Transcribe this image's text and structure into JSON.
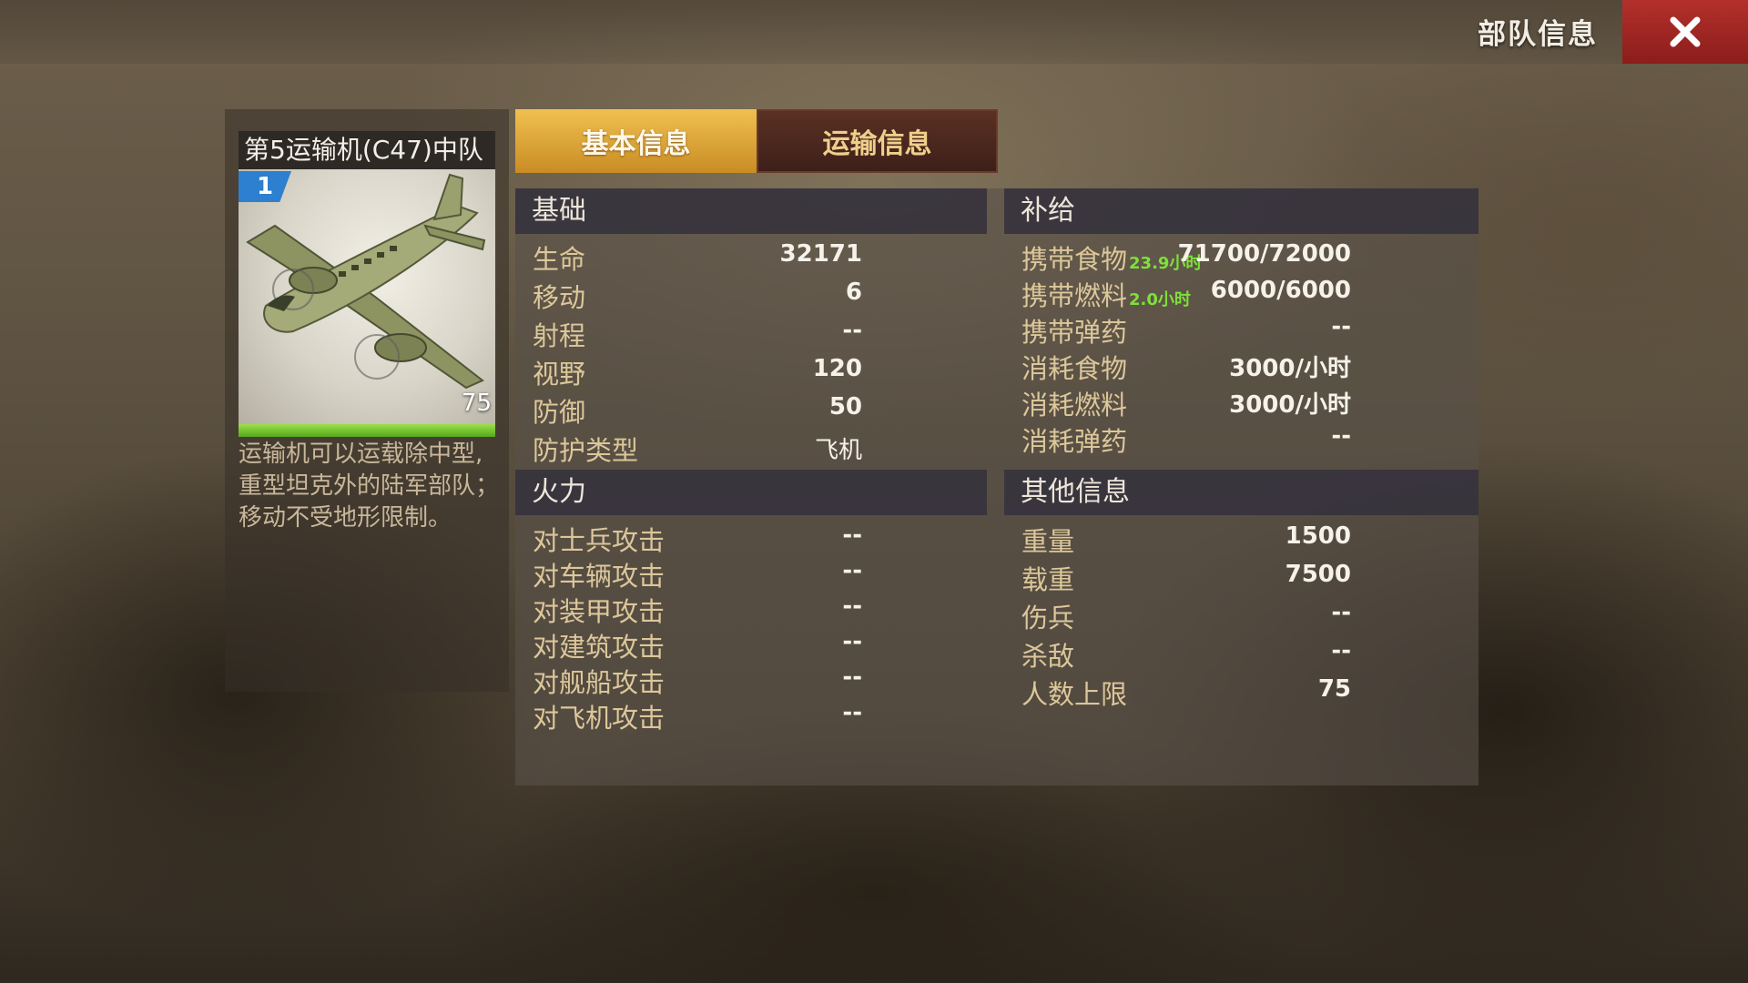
{
  "header": {
    "title": "部队信息"
  },
  "unit": {
    "name": "第5运输机(C47)中队",
    "level": "1",
    "count": "75",
    "hp_fraction": 1.0,
    "description": "运输机可以运载除中型,重型坦克外的陆军部队；移动不受地形限制。"
  },
  "tabs": [
    {
      "label": "基本信息",
      "active": true
    },
    {
      "label": "运输信息",
      "active": false
    }
  ],
  "sections": {
    "basic": {
      "title": "基础",
      "rows": [
        {
          "label": "生命",
          "value": "32171"
        },
        {
          "label": "移动",
          "value": "6"
        },
        {
          "label": "射程",
          "value": "--"
        },
        {
          "label": "视野",
          "value": "120"
        },
        {
          "label": "防御",
          "value": "50"
        },
        {
          "label": "防护类型",
          "value": "飞机"
        }
      ]
    },
    "firepower": {
      "title": "火力",
      "rows": [
        {
          "label": "对士兵攻击",
          "value": "--"
        },
        {
          "label": "对车辆攻击",
          "value": "--"
        },
        {
          "label": "对装甲攻击",
          "value": "--"
        },
        {
          "label": "对建筑攻击",
          "value": "--"
        },
        {
          "label": "对舰船攻击",
          "value": "--"
        },
        {
          "label": "对飞机攻击",
          "value": "--"
        }
      ]
    },
    "supply": {
      "title": "补给",
      "rows": [
        {
          "label": "携带食物",
          "hint": "23.9小时",
          "value": "71700/72000"
        },
        {
          "label": "携带燃料",
          "hint": "2.0小时",
          "value": "6000/6000"
        },
        {
          "label": "携带弹药",
          "hint": "",
          "value": "--"
        },
        {
          "label": "消耗食物",
          "hint": "",
          "value": "3000/小时"
        },
        {
          "label": "消耗燃料",
          "hint": "",
          "value": "3000/小时"
        },
        {
          "label": "消耗弹药",
          "hint": "",
          "value": "--"
        }
      ]
    },
    "other": {
      "title": "其他信息",
      "rows": [
        {
          "label": "重量",
          "value": "1500"
        },
        {
          "label": "载重",
          "value": "7500"
        },
        {
          "label": "伤兵",
          "value": "--"
        },
        {
          "label": "杀敌",
          "value": "--"
        },
        {
          "label": "人数上限",
          "value": "75"
        }
      ]
    }
  },
  "colors": {
    "accent_tab": "#e0a83a",
    "close_button": "#a82a27",
    "hint_green": "#7ee03a",
    "label_gold": "#dcc79a"
  },
  "icons": {
    "close": "close-x-icon",
    "unit_image": "c47-transport-plane"
  }
}
